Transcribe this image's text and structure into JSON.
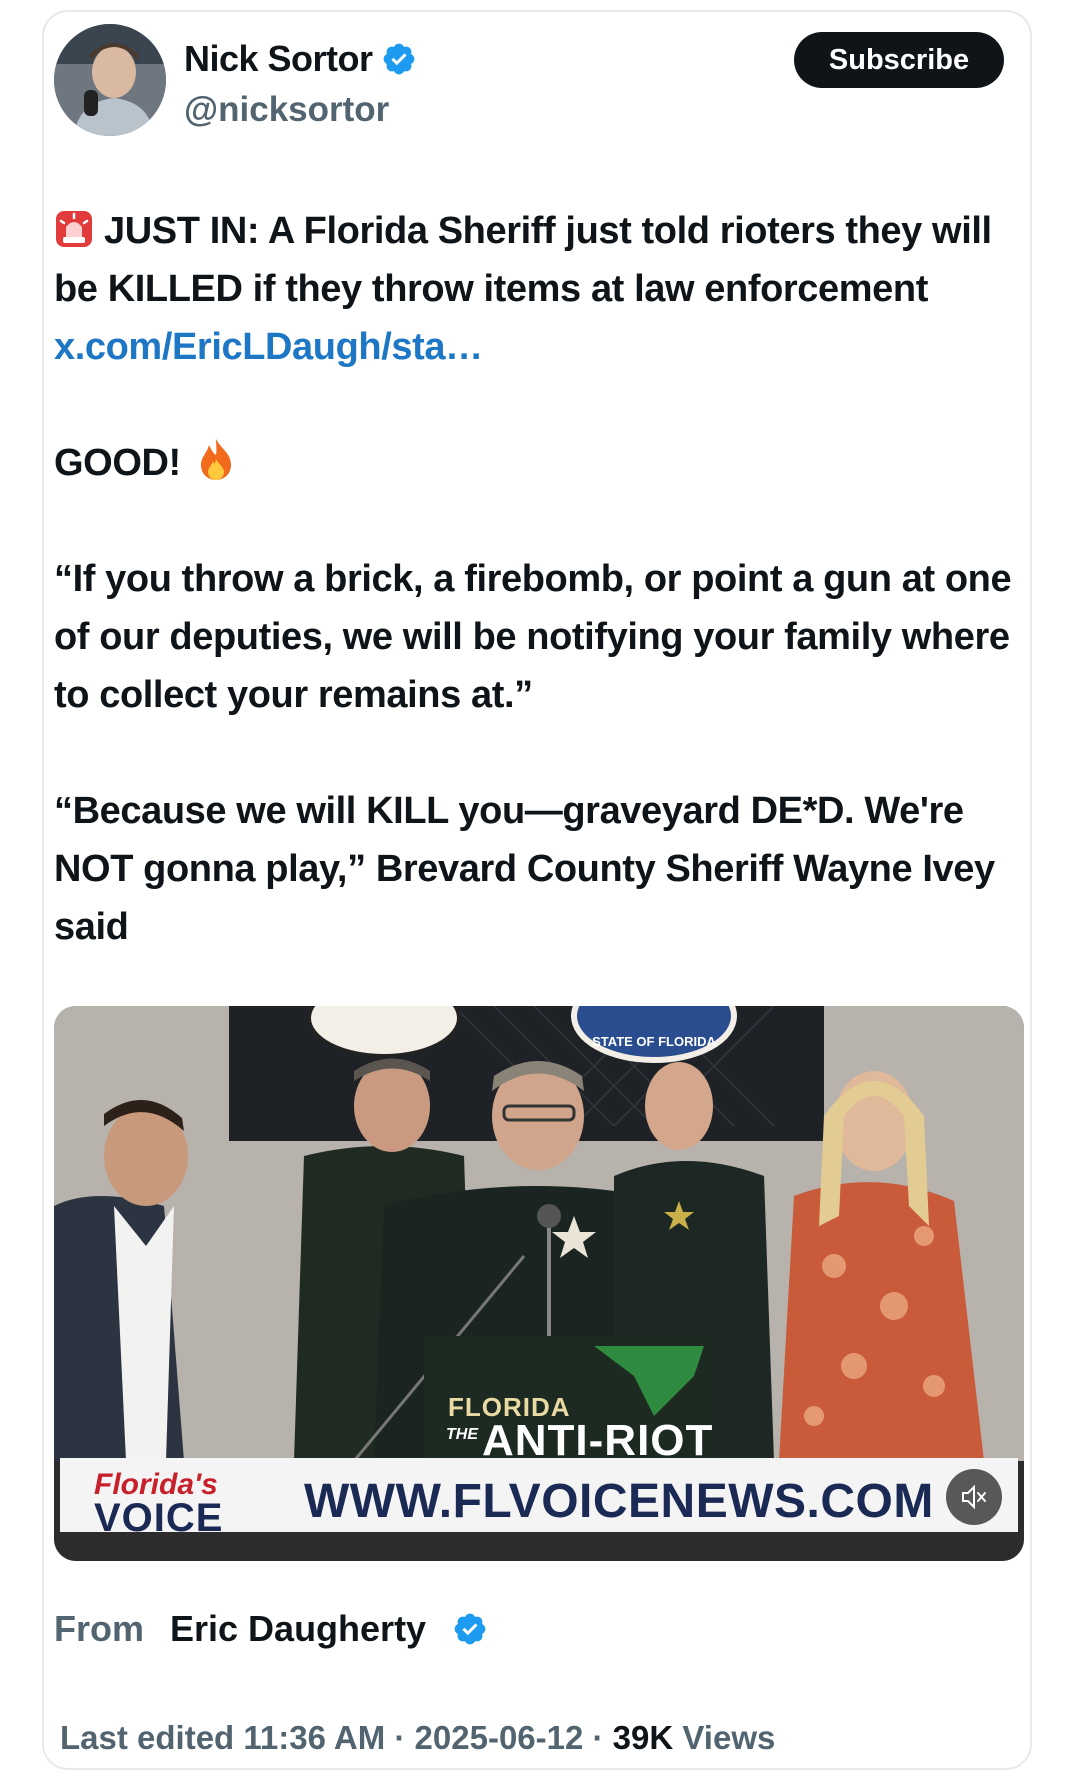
{
  "author": {
    "display_name": "Nick Sortor",
    "handle": "@nicksortor",
    "verified": true
  },
  "subscribe_label": "Subscribe",
  "tweet": {
    "line1_prefix": "JUST IN: A Florida Sheriff just told rioters they will be KILLED if they throw items at law enforcement",
    "link_text": "x.com/EricLDaugh/sta…",
    "para2": "GOOD!",
    "para3": "“If you throw a brick, a firebomb, or point a gun at one of our deputies, we will be notifying your family where to collect your remains at.”",
    "para4": "“Because we will KILL you—graveyard DE*D. We're NOT gonna play,” Brevard County Sheriff Wayne Ivey said",
    "emoji_1": "rotating-light-icon",
    "emoji_2": "fire-icon"
  },
  "media": {
    "podium_line1": "FLORIDA",
    "podium_the": "THE",
    "podium_line2": "ANTI-RIOT",
    "banner_logo_top": "Florida's",
    "banner_logo_bottom": "VOICE",
    "banner_url": "WWW.FLVOICENEWS.COM",
    "seal_text": "STATE OF FLORIDA"
  },
  "from": {
    "label": "From",
    "name": "Eric Daugherty"
  },
  "meta": {
    "edited": "Last edited 11:36 AM · 2025-06-12 · ",
    "views_count": "39K",
    "views_label": " Views"
  },
  "colors": {
    "link": "#1d77c5",
    "verified": "#1d9bf0",
    "subscribe_bg": "#0f1419",
    "secondary_text": "#536471"
  }
}
